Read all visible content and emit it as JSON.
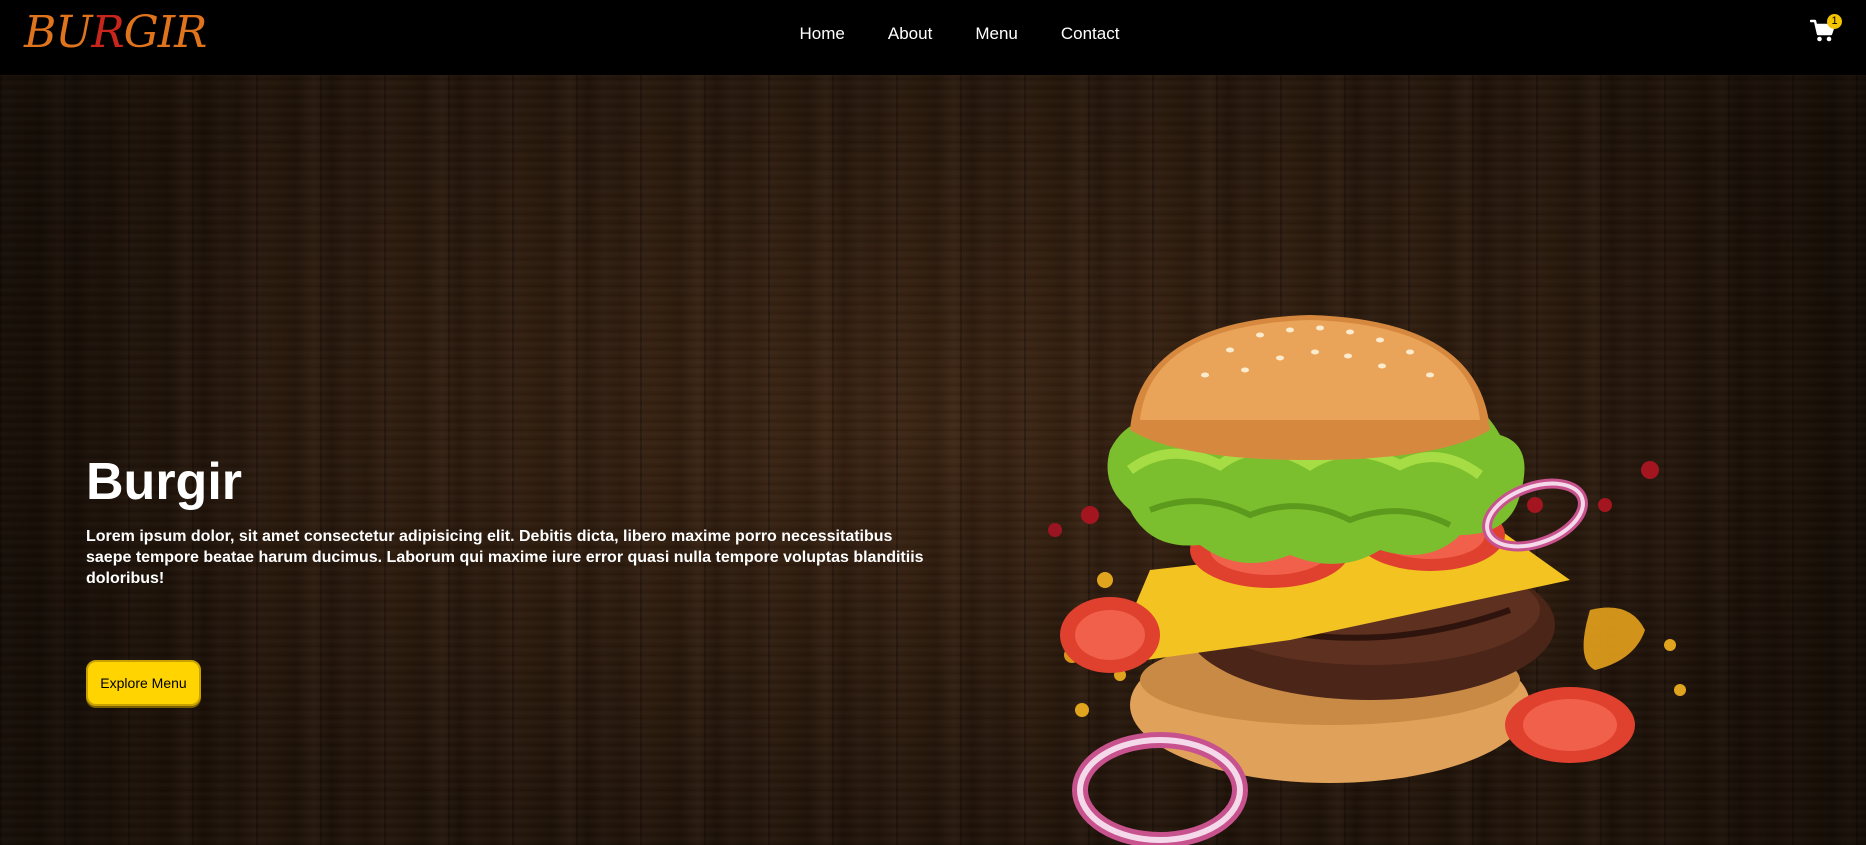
{
  "header": {
    "logo": {
      "letters": [
        "B",
        "U",
        "R",
        "G",
        "I",
        "R"
      ],
      "colors": [
        "#e0741c",
        "#e0741c",
        "#c8261d",
        "#e0741c",
        "#e0741c",
        "#e0741c"
      ]
    },
    "nav": [
      {
        "label": "Home"
      },
      {
        "label": "About"
      },
      {
        "label": "Menu"
      },
      {
        "label": "Contact"
      }
    ],
    "cart": {
      "icon": "cart-icon",
      "count": "1"
    }
  },
  "hero": {
    "title": "Burgir",
    "description": "Lorem ipsum dolor, sit amet consectetur adipisicing elit. Debitis dicta, libero maxime porro necessitatibus saepe tempore beatae harum ducimus. Laborum qui maxime iure error quasi nulla tempore voluptas blanditiis doloribus!",
    "cta_label": "Explore Menu",
    "image": "burger-image"
  },
  "colors": {
    "accent": "#ffd400",
    "navbar": "#000000",
    "wood": "#33200f"
  }
}
